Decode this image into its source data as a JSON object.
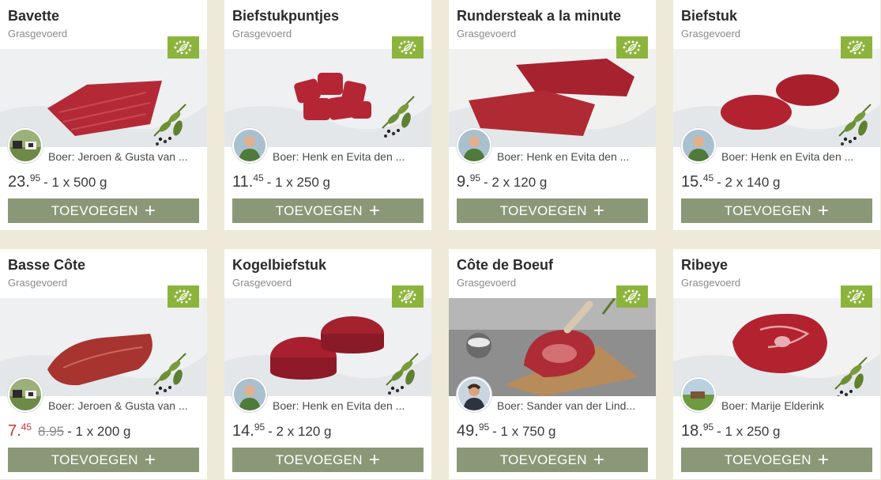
{
  "products": [
    {
      "title": "Bavette",
      "subtitle": "Grasgevoerd",
      "farmer": "Boer: Jeroen & Gusta van ...",
      "price_int": "23.",
      "price_dec": "95",
      "old_price": "",
      "quantity": "- 1 x 500 g",
      "button_label": "TOEVOEGEN",
      "sale": false,
      "photo_icon": "flank-steak",
      "avatar_icon": "cows-avatar"
    },
    {
      "title": "Biefstukpuntjes",
      "subtitle": "Grasgevoerd",
      "farmer": "Boer: Henk en Evita den ...",
      "price_int": "11.",
      "price_dec": "45",
      "old_price": "",
      "quantity": "- 1 x 250 g",
      "button_label": "TOEVOEGEN",
      "sale": false,
      "photo_icon": "beef-cubes",
      "avatar_icon": "farmer-avatar"
    },
    {
      "title": "Rundersteak a la minute",
      "subtitle": "Grasgevoerd",
      "farmer": "Boer: Henk en Evita den ...",
      "price_int": "9.",
      "price_dec": "95",
      "old_price": "",
      "quantity": "- 2 x 120 g",
      "button_label": "TOEVOEGEN",
      "sale": false,
      "photo_icon": "two-thin-steaks",
      "avatar_icon": "farmer-avatar"
    },
    {
      "title": "Biefstuk",
      "subtitle": "Grasgevoerd",
      "farmer": "Boer: Henk en Evita den ...",
      "price_int": "15.",
      "price_dec": "45",
      "old_price": "",
      "quantity": "- 2 x 140 g",
      "button_label": "TOEVOEGEN",
      "sale": false,
      "photo_icon": "two-steaks",
      "avatar_icon": "farmer-avatar"
    },
    {
      "title": "Basse Côte",
      "subtitle": "Grasgevoerd",
      "farmer": "Boer: Jeroen & Gusta van ...",
      "price_int": "7.",
      "price_dec": "45",
      "old_price": "8.95",
      "quantity": "- 1 x 200 g",
      "button_label": "TOEVOEGEN",
      "sale": true,
      "photo_icon": "basse-cote-steak",
      "avatar_icon": "cows-avatar"
    },
    {
      "title": "Kogelbiefstuk",
      "subtitle": "Grasgevoerd",
      "farmer": "Boer: Henk en Evita den ...",
      "price_int": "14.",
      "price_dec": "95",
      "old_price": "",
      "quantity": "- 2 x 120 g",
      "button_label": "TOEVOEGEN",
      "sale": false,
      "photo_icon": "two-round-steaks",
      "avatar_icon": "farmer-avatar"
    },
    {
      "title": "Côte de Boeuf",
      "subtitle": "Grasgevoerd",
      "farmer": "Boer: Sander van der Lind...",
      "price_int": "49.",
      "price_dec": "95",
      "old_price": "",
      "quantity": "- 1 x 750 g",
      "button_label": "TOEVOEGEN",
      "sale": false,
      "photo_icon": "cote-de-boeuf",
      "avatar_icon": "sander-avatar"
    },
    {
      "title": "Ribeye",
      "subtitle": "Grasgevoerd",
      "farmer": "Boer: Marije Elderink",
      "price_int": "18.",
      "price_dec": "95",
      "old_price": "",
      "quantity": "- 1 x 250 g",
      "button_label": "TOEVOEGEN",
      "sale": false,
      "photo_icon": "ribeye-steak",
      "avatar_icon": "pasture-avatar"
    }
  ],
  "colors": {
    "button": "#8b9877",
    "bio_badge": "#8cb43c",
    "sale_price": "#d3302f",
    "background": "#efe9da",
    "meat": "#b32a36"
  }
}
